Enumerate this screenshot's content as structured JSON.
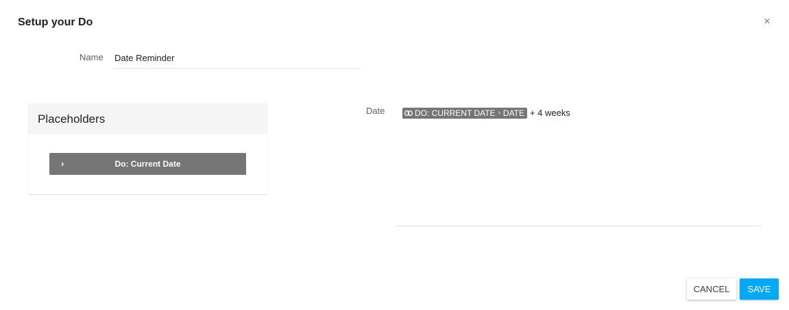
{
  "dialog": {
    "title": "Setup your Do",
    "close_glyph": "×"
  },
  "name_field": {
    "label": "Name",
    "value": "Date Reminder"
  },
  "placeholders": {
    "header": "Placeholders",
    "items": [
      {
        "label": "Do: Current Date",
        "icon": "chevron-right-icon"
      }
    ]
  },
  "date_field": {
    "label": "Date",
    "chip": {
      "part1": "DO: CURRENT DATE",
      "separator": "›",
      "part2": "DATE",
      "icon": "link-icon"
    },
    "suffix": "+ 4 weeks"
  },
  "actions": {
    "cancel_label": "CANCEL",
    "save_label": "SAVE"
  },
  "colors": {
    "save_button": "#03a9f4",
    "placeholder_button": "#757575",
    "chip": "#757575",
    "panel_header": "#f5f5f5"
  }
}
